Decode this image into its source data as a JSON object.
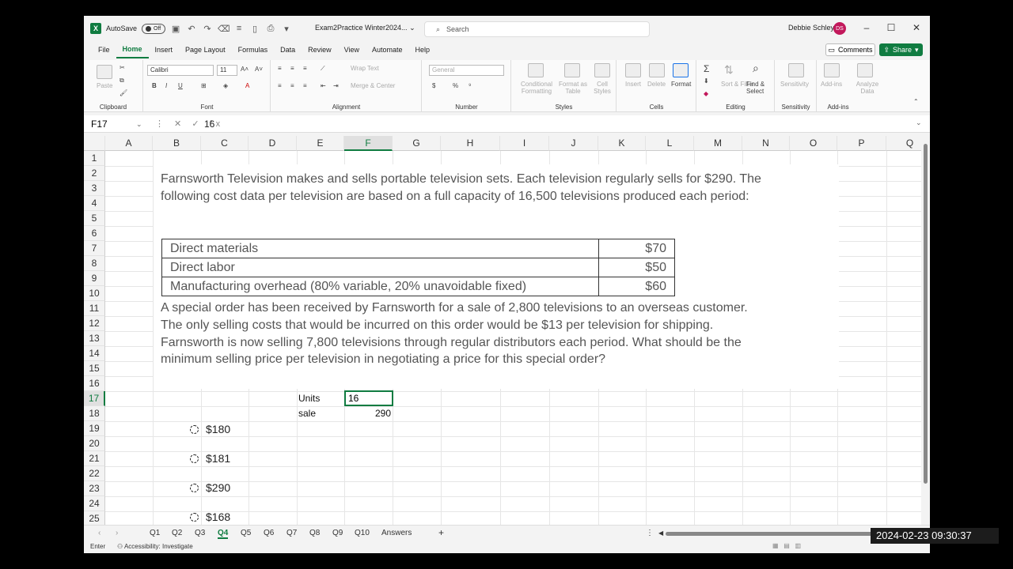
{
  "titlebar": {
    "autosave_label": "AutoSave",
    "autosave_state": "Off",
    "doc_title": "Exam2Practice Winter2024...",
    "search_placeholder": "Search",
    "user_name": "Debbie Schley",
    "user_initials": "DS"
  },
  "menu": {
    "items": [
      "File",
      "Home",
      "Insert",
      "Page Layout",
      "Formulas",
      "Data",
      "Review",
      "View",
      "Automate",
      "Help"
    ],
    "active": "Home",
    "comments_label": "Comments",
    "share_label": "Share"
  },
  "ribbon": {
    "clipboard": {
      "label": "Clipboard",
      "paste": "Paste"
    },
    "font": {
      "label": "Font",
      "name": "Calibri",
      "size": "11"
    },
    "alignment": {
      "label": "Alignment",
      "wrap": "Wrap Text",
      "merge": "Merge & Center"
    },
    "number": {
      "label": "Number",
      "format": "General"
    },
    "styles": {
      "label": "Styles",
      "conditional": "Conditional Formatting",
      "format_table": "Format as Table",
      "cell_styles": "Cell Styles"
    },
    "cells": {
      "label": "Cells",
      "insert": "Insert",
      "delete": "Delete",
      "format": "Format"
    },
    "editing": {
      "label": "Editing",
      "sort": "Sort & Filter",
      "find": "Find & Select"
    },
    "sensitivity": {
      "label": "Sensitivity",
      "btn": "Sensitivity"
    },
    "addins": {
      "label": "Add-ins",
      "btn": "Add-ins",
      "analyze": "Analyze Data"
    }
  },
  "formula_bar": {
    "name_box": "F17",
    "value": "16"
  },
  "grid": {
    "columns": [
      "A",
      "B",
      "C",
      "D",
      "E",
      "F",
      "G",
      "H",
      "I",
      "J",
      "K",
      "L",
      "M",
      "N",
      "O",
      "P",
      "Q"
    ],
    "rows": [
      "1",
      "2",
      "3",
      "4",
      "5",
      "6",
      "7",
      "8",
      "9",
      "10",
      "11",
      "12",
      "13",
      "14",
      "15",
      "16",
      "17",
      "18",
      "19",
      "20",
      "21",
      "22",
      "23",
      "24",
      "25"
    ],
    "selected_column": "F",
    "selected_row": "17"
  },
  "problem": {
    "intro_line1": "Farnsworth Television makes and sells portable television sets. Each television regularly sells for $290. The",
    "intro_line2": "following cost data per television are based on a full capacity of 16,500 televisions produced each period:",
    "costs": [
      {
        "item": "Direct materials",
        "amount": "$70"
      },
      {
        "item": "Direct labor",
        "amount": "$50"
      },
      {
        "item": "Manufacturing overhead (80% variable, 20% unavoidable fixed)",
        "amount": "$60"
      }
    ],
    "q_line1": "A special order has been received by Farnsworth for a sale of 2,800 televisions to an overseas customer.",
    "q_line2": "The only selling costs that would be incurred on this order would be $13 per television for shipping.",
    "q_line3": "Farnsworth is now selling 7,800 televisions through regular distributors each period. What should be the",
    "q_line4": "minimum selling price per television in negotiating a price for this special order?"
  },
  "cells": {
    "e17": "Units",
    "f17": "16",
    "e18": "sale",
    "f18": "290"
  },
  "choices": [
    "$180",
    "$181",
    "$290",
    "$168"
  ],
  "sheet_tabs": [
    "Q1",
    "Q2",
    "Q3",
    "Q4",
    "Q5",
    "Q6",
    "Q7",
    "Q8",
    "Q9",
    "Q10",
    "Answers"
  ],
  "active_tab": "Q4",
  "status": {
    "mode": "Enter",
    "accessibility": "Accessibility: Investigate"
  },
  "timestamp": "2024-02-23 09:30:37"
}
